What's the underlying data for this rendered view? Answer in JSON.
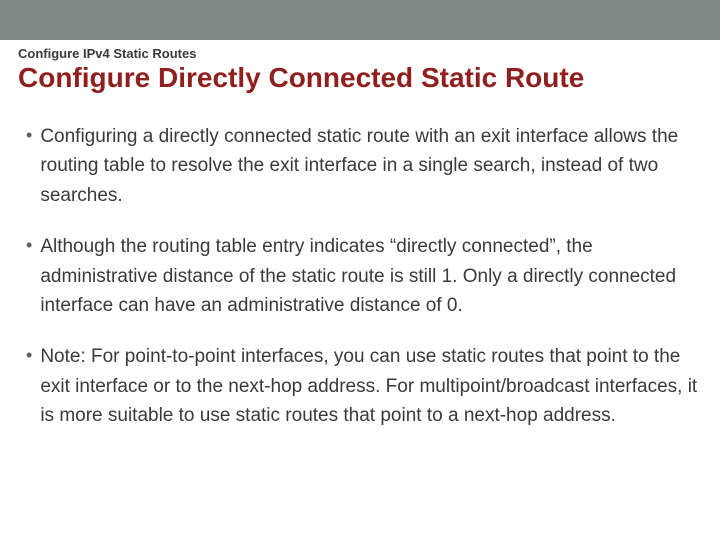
{
  "header": {
    "breadcrumb": "Configure IPv4 Static Routes",
    "title": "Configure Directly Connected Static Route"
  },
  "bullets": [
    "Configuring a directly connected static route with an exit interface allows the routing table to resolve the exit interface in a single search, instead of two searches.",
    "Although the routing table entry indicates “directly connected”, the administrative distance of the static route is still 1. Only a directly connected interface can have an administrative distance of 0.",
    "Note: For point-to-point interfaces, you can use static routes that point to the exit interface or to the next-hop address. For multipoint/broadcast interfaces, it is more suitable to use static routes that point to a next-hop address."
  ]
}
